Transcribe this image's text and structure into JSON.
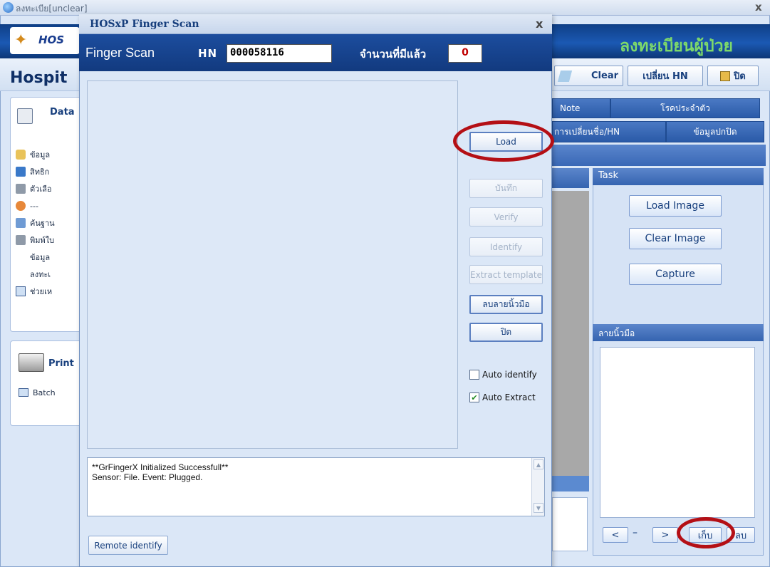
{
  "background_app": {
    "title": "ลงทะเบีย[unclear]",
    "close_glyph": "x",
    "logo_text": "HOS",
    "right_title": "ลงทะเบียนผู้ป่วย",
    "hospital_label": "Hospit",
    "sidebar": {
      "data_header": "Data",
      "items": [
        "ข้อมูล",
        "สิทธิก",
        "ตัวเลือ",
        "---",
        "ค้นฐาน",
        "พิมพ์ใบ",
        "ข้อมูล",
        "ลงทะเ",
        "ช่วยเห"
      ]
    },
    "print_header": "Print",
    "batch_label": "Batch",
    "toolbar": {
      "clear": "Clear",
      "change_hn": "เปลี่ยน HN",
      "close": "ปิด"
    },
    "tabs": {
      "note": "Note",
      "disease": "โรคประจำตัว",
      "change_name": "การเปลี่ยนชื่อ/HN",
      "normal_info": "ข้อมูลปกปิด"
    },
    "task": {
      "header": "Task",
      "load_image": "Load Image",
      "clear_image": "Clear Image",
      "capture": "Capture"
    },
    "fingerprint_header": "ลายนิ้วมือ",
    "nav": {
      "prev": "<",
      "dash": "–",
      "next": ">",
      "save": "เก็บ",
      "delete": "ลบ"
    }
  },
  "dialog": {
    "title": "HOSxP Finger Scan",
    "close_glyph": "x",
    "header_label": "Finger Scan",
    "hn_label": "HN",
    "hn_value": "000058116",
    "count_label": "จำนวนที่มีแล้ว",
    "count_value": "0",
    "buttons": {
      "load": "Load",
      "save": "บันทึก",
      "verify": "Verify",
      "identify": "Identify",
      "extract_template": "Extract template",
      "delete_fingerprint": "ลบลายนิ้วมือ",
      "close": "ปิด",
      "remote_identify": "Remote identify"
    },
    "checkboxes": {
      "auto_identify": {
        "label": "Auto identify",
        "checked": false
      },
      "auto_extract": {
        "label": "Auto Extract",
        "checked": true
      }
    },
    "log_lines": [
      "**GrFingerX Initialized Successfull**",
      "Sensor: File. Event: Plugged."
    ]
  },
  "annotation_color": "#b40f15"
}
